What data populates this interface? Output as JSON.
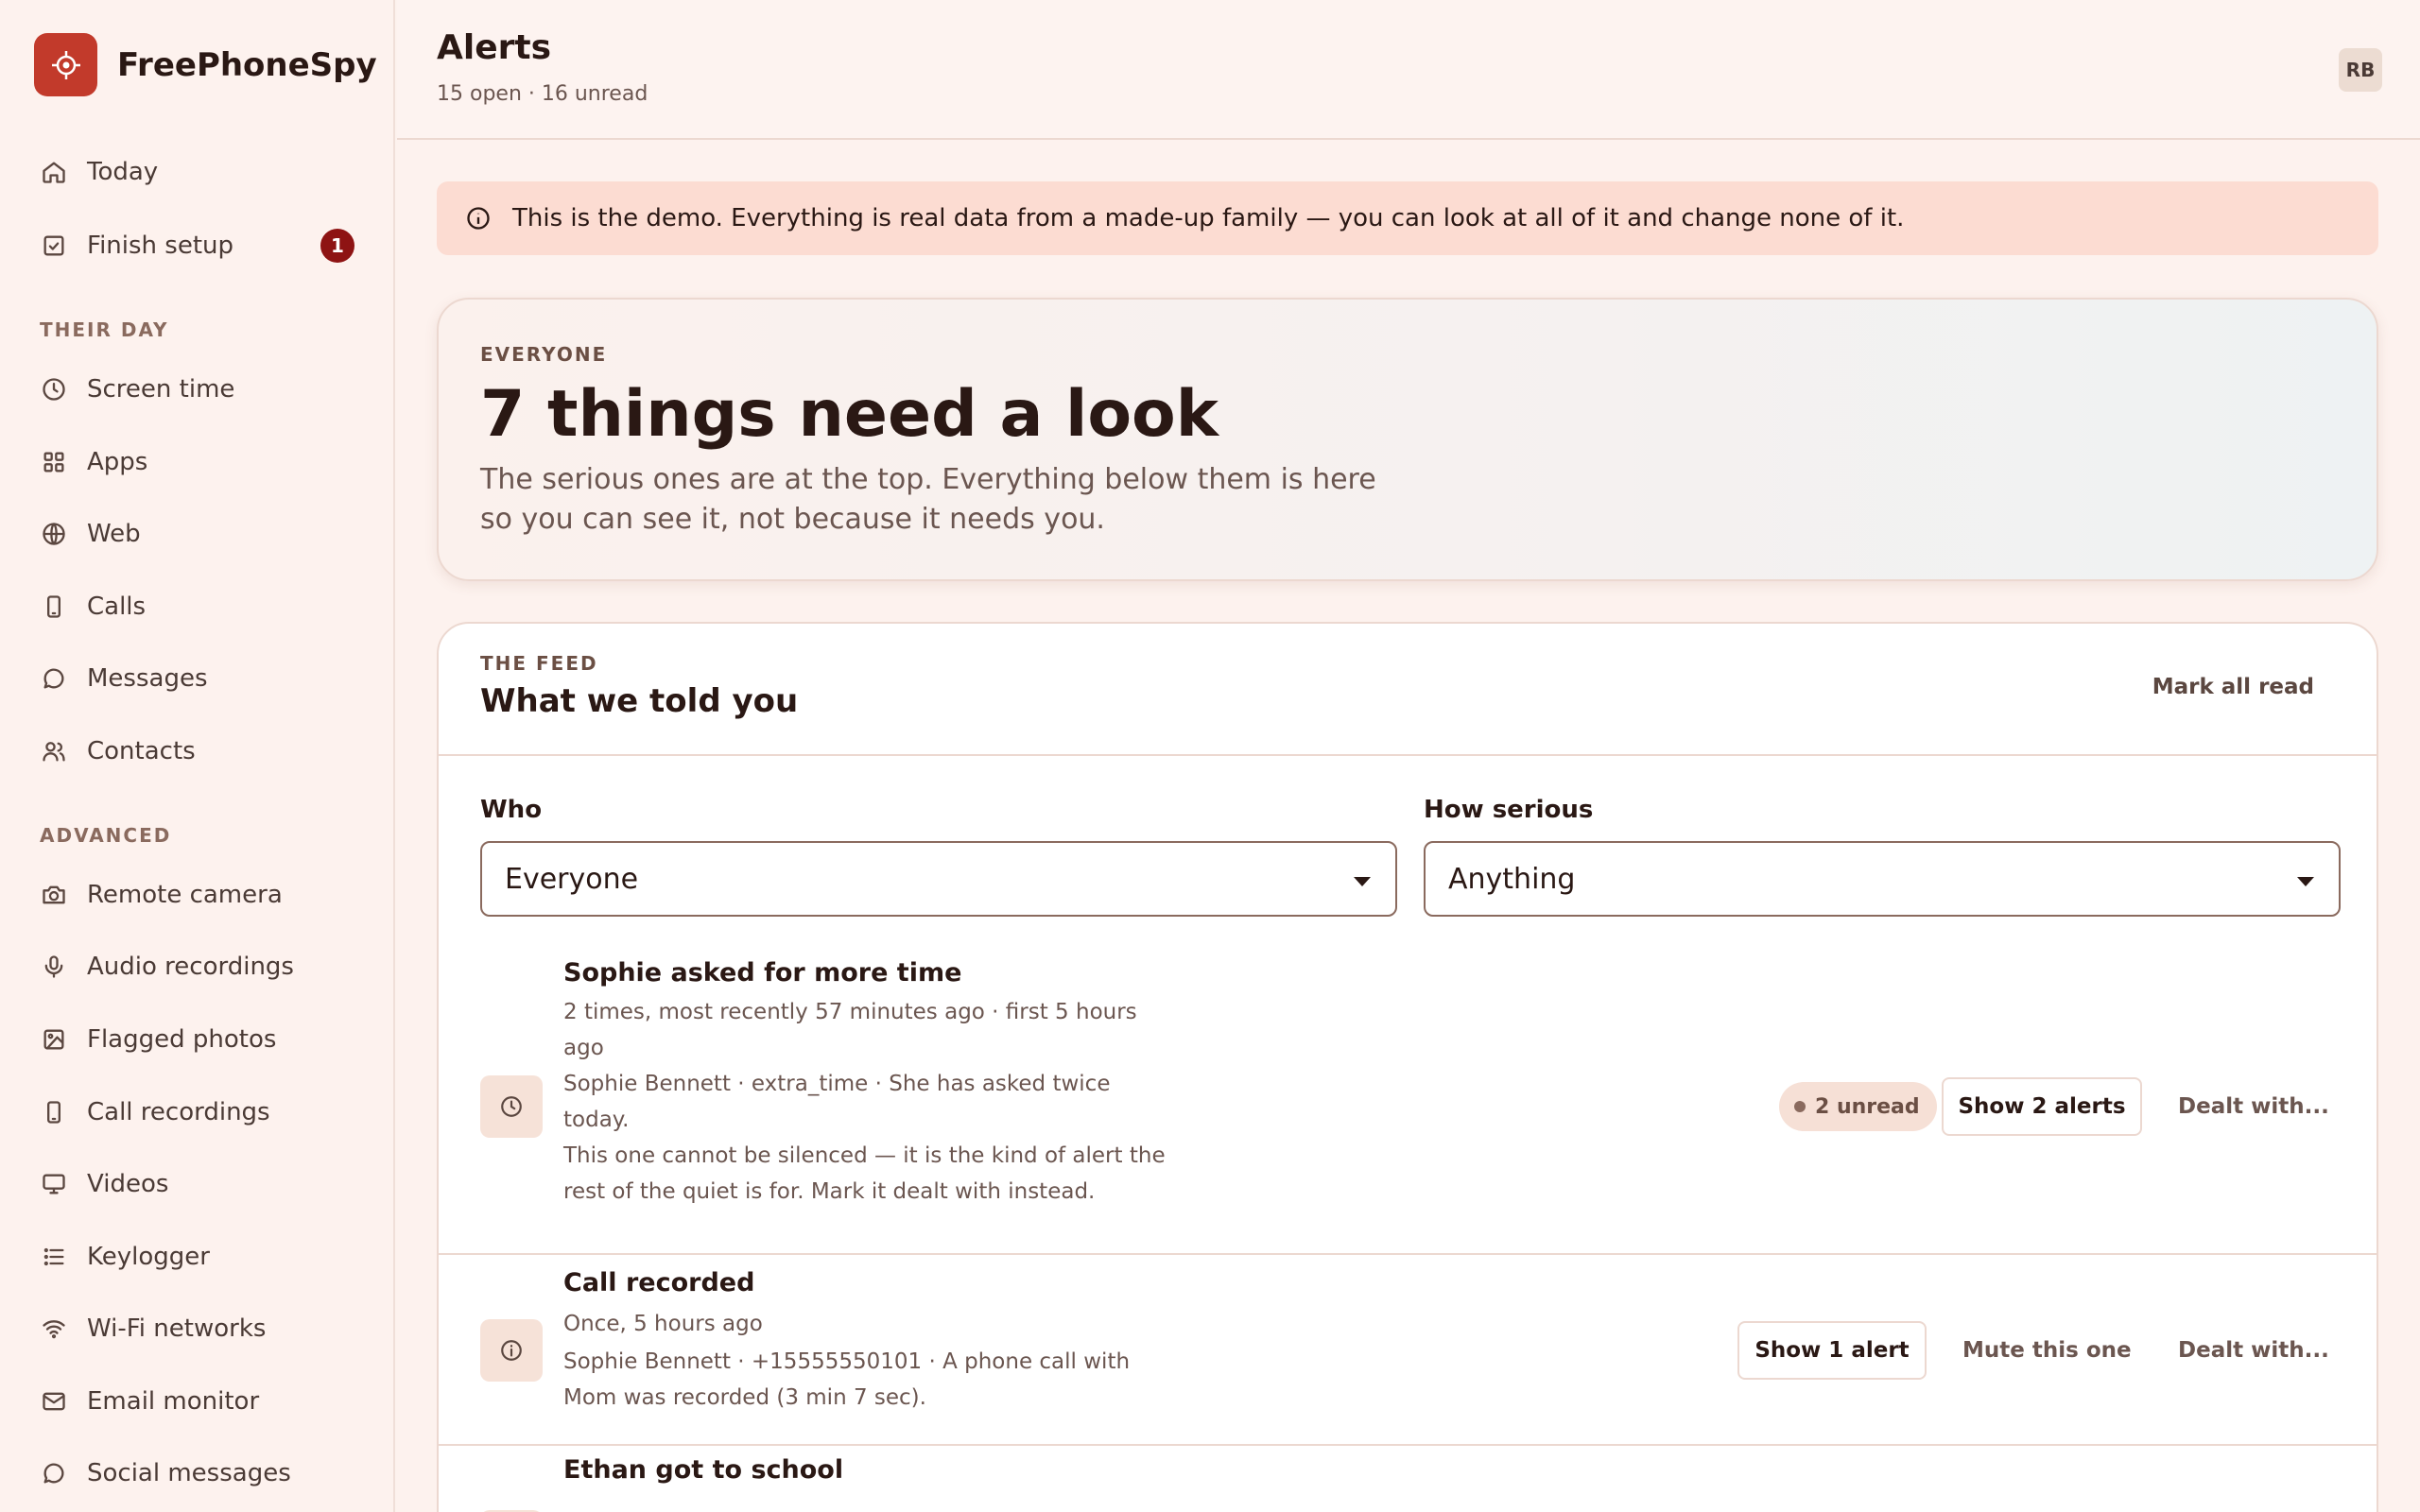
{
  "brand": {
    "name": "FreePhoneSpy",
    "logo_icon": "target-icon",
    "logo_color": "#c23a2b"
  },
  "sidebar": {
    "items": [
      {
        "label": "Today",
        "icon": "home-icon"
      },
      {
        "label": "Finish setup",
        "icon": "checkbox-icon",
        "badge": "1"
      }
    ],
    "sections": [
      {
        "title": "THEIR DAY",
        "items": [
          {
            "label": "Screen time",
            "icon": "clock-icon"
          },
          {
            "label": "Apps",
            "icon": "grid-icon"
          },
          {
            "label": "Web",
            "icon": "globe-icon"
          },
          {
            "label": "Calls",
            "icon": "phone-icon"
          },
          {
            "label": "Messages",
            "icon": "chat-icon"
          },
          {
            "label": "Contacts",
            "icon": "users-icon"
          }
        ]
      },
      {
        "title": "ADVANCED",
        "items": [
          {
            "label": "Remote camera",
            "icon": "camera-icon"
          },
          {
            "label": "Audio recordings",
            "icon": "microphone-icon"
          },
          {
            "label": "Flagged photos",
            "icon": "image-icon"
          },
          {
            "label": "Call recordings",
            "icon": "phone-icon"
          },
          {
            "label": "Videos",
            "icon": "monitor-icon"
          },
          {
            "label": "Keylogger",
            "icon": "list-icon"
          },
          {
            "label": "Wi-Fi networks",
            "icon": "wifi-icon"
          },
          {
            "label": "Email monitor",
            "icon": "mail-icon"
          },
          {
            "label": "Social messages",
            "icon": "chat-icon"
          }
        ]
      }
    ]
  },
  "header": {
    "title": "Alerts",
    "subtitle": "15 open · 16 unread",
    "avatar": "RB"
  },
  "banner": {
    "text": "This is the demo. Everything is real data from a made-up family — you can look at all of it and change none of it.",
    "icon": "info-icon"
  },
  "hero": {
    "eyebrow": "EVERYONE",
    "title": "7 things need a look",
    "description": "The serious ones are at the top. Everything below them is here so you can see it, not because it needs you."
  },
  "feed": {
    "eyebrow": "THE FEED",
    "title": "What we told you",
    "mark_all_read": "Mark all read",
    "filters": {
      "who": {
        "label": "Who",
        "value": "Everyone"
      },
      "serious": {
        "label": "How serious",
        "value": "Anything"
      }
    },
    "alerts": [
      {
        "title": "Sophie asked for more time",
        "icon": "clock-icon",
        "when": "2 times, most recently 57 minutes ago · first 5 hours ago",
        "detail": "Sophie Bennett · extra_time · She has asked twice today.",
        "note": "This one cannot be silenced — it is the kind of alert the rest of the quiet is for. Mark it dealt with instead.",
        "unread": "2 unread",
        "show": "Show 2 alerts",
        "dealt": "Dealt with..."
      },
      {
        "title": "Call recorded",
        "icon": "info-icon",
        "when": "Once, 5 hours ago",
        "detail": "Sophie Bennett · +15555550101 · A phone call with Mom was recorded (3 min 7 sec).",
        "show": "Show 1 alert",
        "mute": "Mute this one",
        "dealt": "Dealt with..."
      },
      {
        "title": "Ethan got to school",
        "icon": "info-icon"
      }
    ]
  }
}
